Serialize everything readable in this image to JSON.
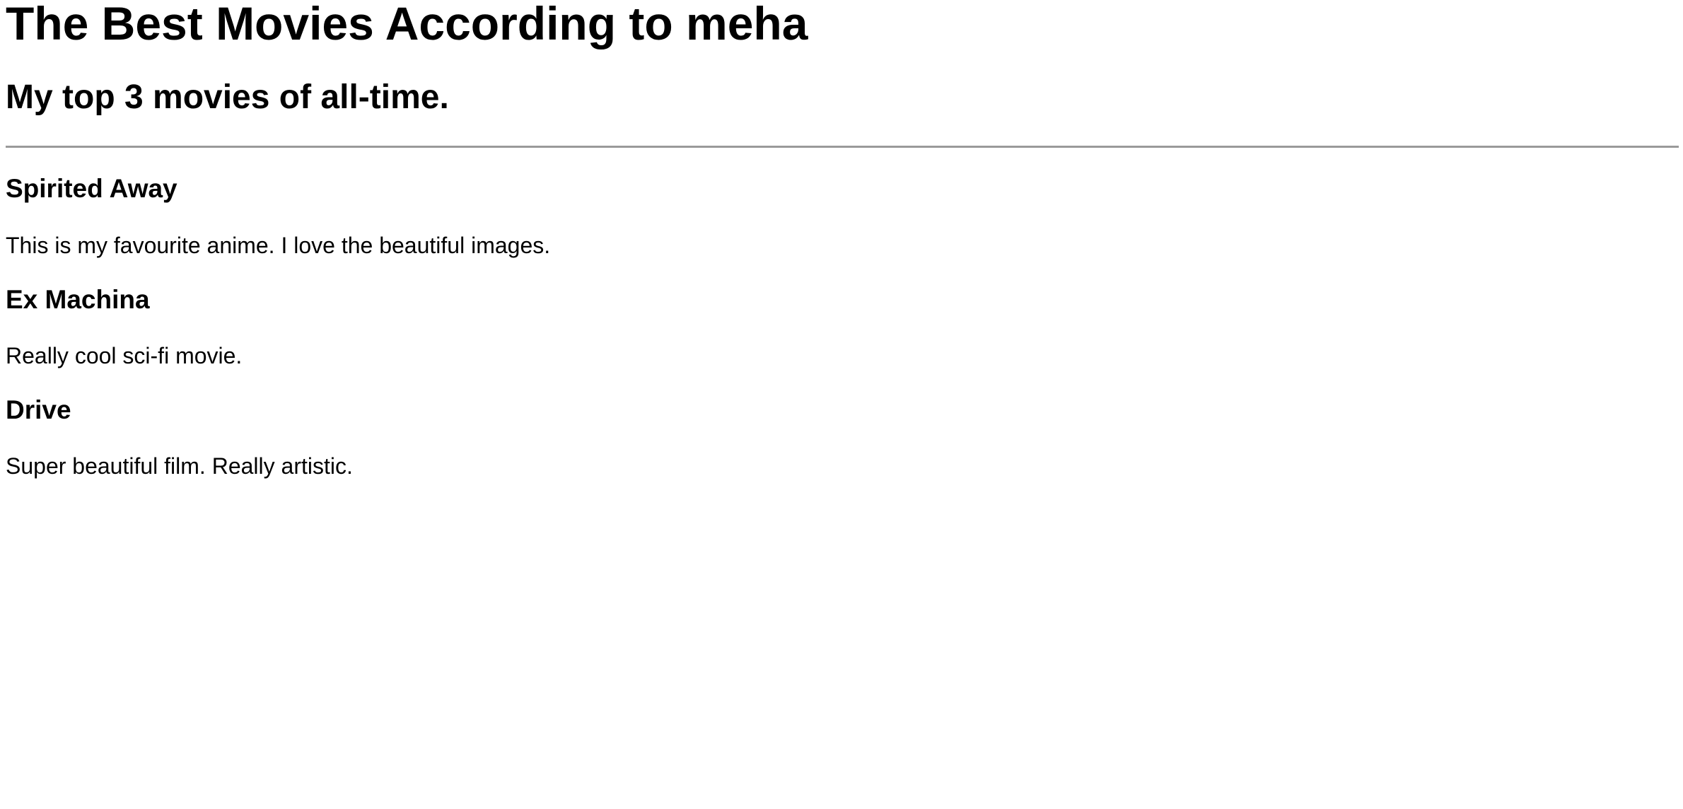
{
  "header": {
    "title": "The Best Movies According to meha",
    "subtitle": "My top 3 movies of all-time."
  },
  "movies": [
    {
      "title": "Spirited Away",
      "description": "This is my favourite anime. I love the beautiful images."
    },
    {
      "title": "Ex Machina",
      "description": "Really cool sci-fi movie."
    },
    {
      "title": "Drive",
      "description": "Super beautiful film. Really artistic."
    }
  ]
}
